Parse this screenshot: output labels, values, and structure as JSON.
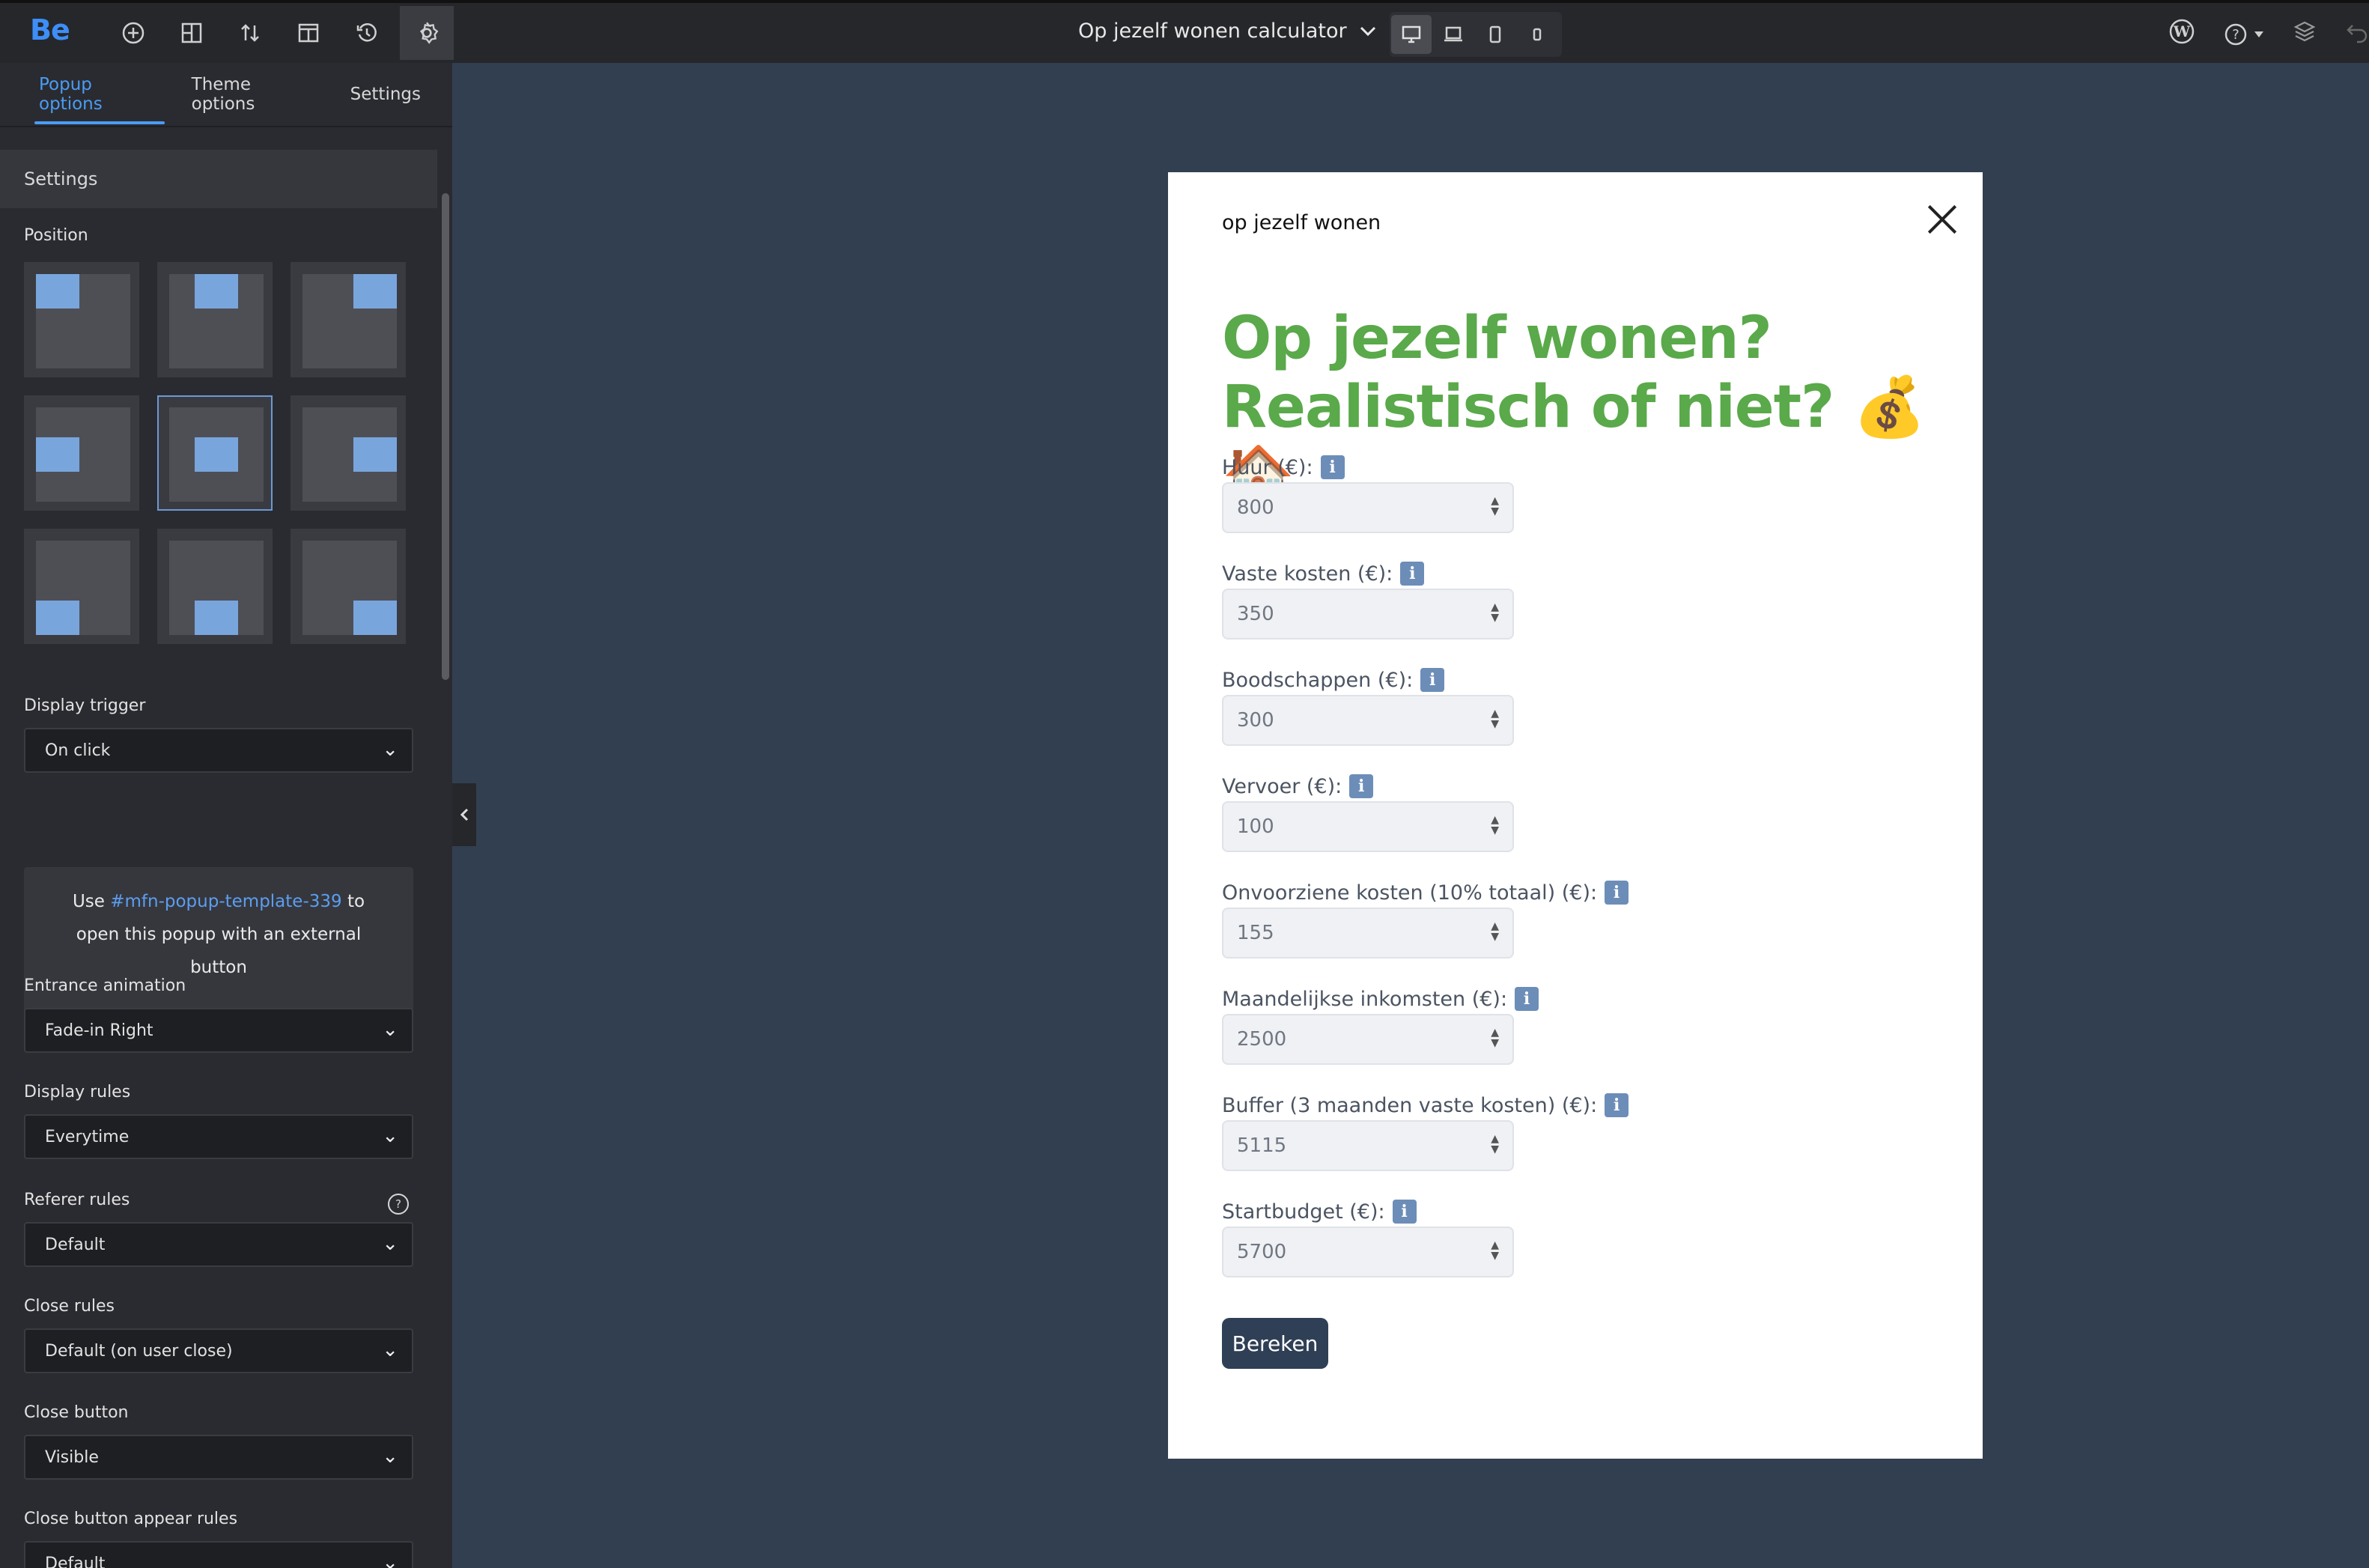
{
  "topbar": {
    "logo": "Be",
    "page_title": "Op jezelf wonen calculator",
    "icons": [
      "add-icon",
      "grid-icon",
      "sort-icon",
      "layout-icon",
      "history-icon",
      "gear-icon"
    ],
    "devices": [
      "desktop",
      "laptop",
      "tablet",
      "mobile"
    ]
  },
  "sidebar": {
    "tabs": [
      {
        "label": "Popup options"
      },
      {
        "label": "Theme options"
      },
      {
        "label": "Settings"
      }
    ],
    "section_title": "Settings",
    "position_label": "Position",
    "display_trigger": {
      "label": "Display trigger",
      "value": "On click"
    },
    "info": {
      "prefix": "Use ",
      "link": "#mfn-popup-template-339",
      "suffix": " to open this popup with an external button"
    },
    "entrance_animation": {
      "label": "Entrance animation",
      "value": "Fade-in Right"
    },
    "display_rules": {
      "label": "Display rules",
      "value": "Everytime"
    },
    "referer_rules": {
      "label": "Referer rules",
      "value": "Default"
    },
    "close_rules": {
      "label": "Close rules",
      "value": "Default (on user close)"
    },
    "close_button": {
      "label": "Close button",
      "value": "Visible"
    },
    "close_button_appear_rules": {
      "label": "Close button appear rules",
      "value": "Default"
    }
  },
  "popup": {
    "small_title": "op jezelf wonen",
    "headline_line1": "Op jezelf wonen?",
    "headline_line2": "Realistisch of niet? 💰🏠",
    "info_glyph": "i",
    "fields": [
      {
        "label": "Huur (€):",
        "value": "800"
      },
      {
        "label": "Vaste kosten (€):",
        "value": "350"
      },
      {
        "label": "Boodschappen (€):",
        "value": "300"
      },
      {
        "label": "Vervoer (€):",
        "value": "100"
      },
      {
        "label": "Onvoorziene kosten (10% totaal) (€):",
        "value": "155"
      },
      {
        "label": "Maandelijkse inkomsten (€):",
        "value": "2500"
      },
      {
        "label": "Buffer (3 maanden vaste kosten) (€):",
        "value": "5115"
      },
      {
        "label": "Startbudget (€):",
        "value": "5700"
      }
    ],
    "button_label": "Bereken"
  },
  "colors": {
    "accent_blue": "#4a9cf5",
    "headline_green": "#5aa94a",
    "button_navy": "#2f3f55",
    "canvas_bg": "#323f51"
  }
}
